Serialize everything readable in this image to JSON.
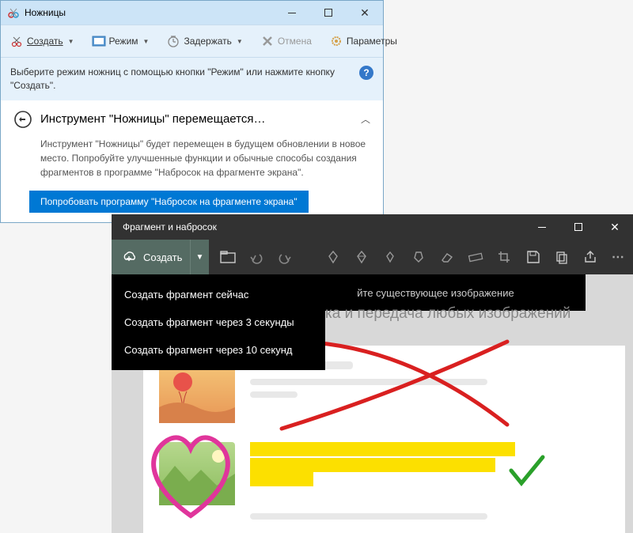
{
  "snippingTool": {
    "title": "Ножницы",
    "toolbar": {
      "new": "Создать",
      "mode": "Режим",
      "delay": "Задержать",
      "cancel": "Отмена",
      "options": "Параметры"
    },
    "info": "Выберите режим ножниц с помощью кнопки \"Режим\" или нажмите кнопку \"Создать\".",
    "notification": {
      "title": "Инструмент \"Ножницы\" перемещается…",
      "body": "Инструмент \"Ножницы\" будет перемещен в будущем обновлении в новое место. Попробуйте улучшенные функции и обычные способы создания фрагментов в программе \"Набросок на фрагменте экрана\".",
      "button": "Попробовать программу \"Набросок на фрагменте экрана\""
    }
  },
  "snipSketch": {
    "title": "Фрагмент и набросок",
    "newButton": "Создать",
    "menu": {
      "now": "Создать фрагмент сейчас",
      "in3": "Создать фрагмент через 3 секунды",
      "in10": "Создать фрагмент через 10 секунд"
    },
    "overlayText": "йте существующее изображение",
    "headerText": "ка и передача любых изображений"
  }
}
